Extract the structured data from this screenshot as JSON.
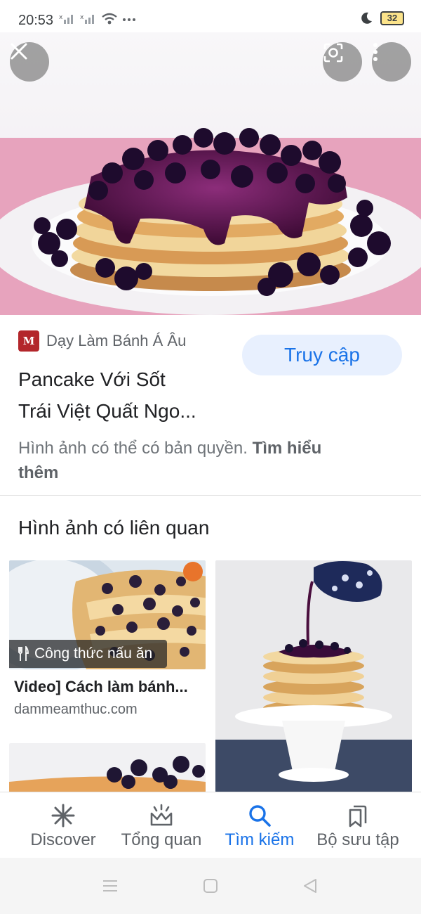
{
  "status_bar": {
    "time": "20:53",
    "battery": "32"
  },
  "image_viewer": {
    "close_icon": "close-icon",
    "lens_icon": "lens-icon",
    "more_icon": "more-vert-icon"
  },
  "result": {
    "source_name": "Dạy Làm Bánh Á Âu",
    "visit_label": "Truy cập",
    "title_line1": "Pancake Với Sốt",
    "title_line2": "Trái Việt Quất Ngo...",
    "copyright_text": "Hình ảnh có thể có bản quyền.",
    "learn_more_line1": "Tìm hiểu",
    "learn_more_line2": "thêm"
  },
  "related": {
    "heading": "Hình ảnh có liên quan",
    "cards": [
      {
        "chip": "Công thức nấu ăn",
        "title": "Video] Cách làm bánh...",
        "domain": "dammeamthuc.com"
      }
    ]
  },
  "bottom_nav": {
    "items": [
      {
        "label": "Discover",
        "icon": "asterisk-icon",
        "active": false
      },
      {
        "label": "Tổng quan",
        "icon": "crown-icon",
        "active": false
      },
      {
        "label": "Tìm kiếm",
        "icon": "search-icon",
        "active": true
      },
      {
        "label": "Bộ sưu tập",
        "icon": "bookmark-icon",
        "active": false
      }
    ]
  },
  "colors": {
    "accent": "#1a73e8",
    "accent_bg": "#e8f0fe",
    "source_logo": "#b3262b"
  }
}
